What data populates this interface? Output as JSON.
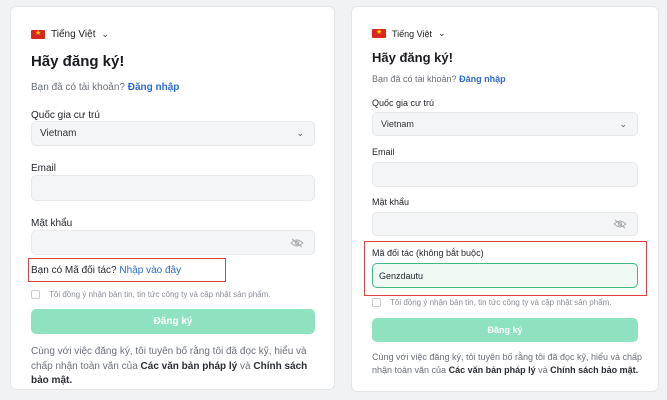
{
  "left": {
    "language": "Tiếng Việt",
    "title": "Hãy đăng ký!",
    "account_prompt": "Bạn đã có tài khoản?",
    "login_link": "Đăng nhập",
    "country_label": "Quốc gia cư trú",
    "country_value": "Vietnam",
    "email_label": "Email",
    "password_label": "Mật khẩu",
    "partner_prompt": "Bạn có Mã đối tác?",
    "partner_link": "Nhập vào đây",
    "consent_text": "Tôi đồng ý nhận bản tin, tin tức công ty và cập nhật sản phẩm.",
    "submit_label": "Đăng ký",
    "legal_text": "Cùng với việc đăng ký, tôi tuyên bố rằng tôi đã đọc kỹ, hiểu và chấp nhận toàn văn của",
    "legal_link1": "Các văn bản pháp lý",
    "legal_and": "và",
    "legal_link2": "Chính sách bảo mật."
  },
  "right": {
    "language": "Tiếng Việt",
    "title": "Hãy đăng ký!",
    "account_prompt": "Bạn đã có tài khoản?",
    "login_link": "Đăng nhập",
    "country_label": "Quốc gia cư trú",
    "country_value": "Vietnam",
    "email_label": "Email",
    "password_label": "Mật khẩu",
    "partner_label": "Mã đối tác (không bắt buộc)",
    "partner_value": "Genzdautu",
    "consent_text": "Tôi đồng ý nhận bản tin, tin tức công ty và cập nhật sản phẩm.",
    "submit_label": "Đăng ký",
    "legal_text": "Cùng với việc đăng ký, tôi tuyên bố rằng tôi đã đọc kỹ, hiểu và chấp nhận toàn văn của",
    "legal_link1": "Các văn bản pháp lý",
    "legal_and": "và",
    "legal_link2": "Chính sách bảo mật."
  },
  "colors": {
    "link": "#2c69d6",
    "button": "#8fe2bf",
    "highlight_box": "#e0433f",
    "active_input_border": "#3fb883"
  }
}
